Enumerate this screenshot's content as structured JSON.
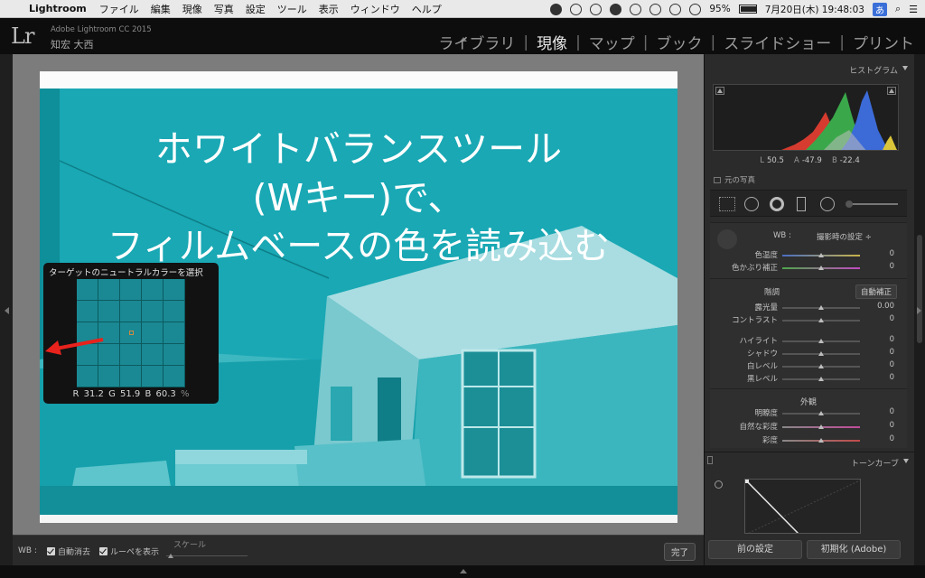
{
  "menubar": {
    "app_name": "Lightroom",
    "menus": [
      "ファイル",
      "編集",
      "現像",
      "写真",
      "設定",
      "ツール",
      "表示",
      "ウィンドウ",
      "ヘルプ"
    ],
    "battery": "95%",
    "datetime": "7月20日(木) 19:48:03",
    "ime": "あ"
  },
  "header": {
    "product": "Adobe Lightroom CC 2015",
    "user": "知宏 大西",
    "modules": [
      "ライブラリ",
      "現像",
      "マップ",
      "ブック",
      "スライドショー",
      "プリント"
    ],
    "active_module": "現像"
  },
  "overlay": {
    "line1": "ホワイトバランスツール",
    "line2": "(Wキー)で、",
    "line3": "フィルムベースの色を読み込む"
  },
  "loupe": {
    "title": "ターゲットのニュートラルカラーを選択",
    "r_label": "R",
    "r_value": "31.2",
    "g_label": "G",
    "g_value": "51.9",
    "b_label": "B",
    "b_value": "60.3",
    "pct": "%"
  },
  "toolbar": {
    "wb_label": "WB :",
    "auto_dismiss": "自動消去",
    "show_loupe": "ルーペを表示",
    "scale": "スケール",
    "done": "完了"
  },
  "histogram": {
    "title": "ヒストグラム",
    "l_label": "L",
    "l_value": "50.5",
    "a_label": "A",
    "a_value": "-47.9",
    "b_label": "B",
    "b_value": "-22.4",
    "original_photo": "元の写真"
  },
  "basic": {
    "wb_label": "WB :",
    "wb_value": "撮影時の設定 ÷",
    "temp_label": "色温度",
    "temp_value": "0",
    "tint_label": "色かぶり補正",
    "tint_value": "0",
    "tone_label": "階調",
    "auto_label": "自動補正",
    "exposure_label": "露光量",
    "exposure_value": "0.00",
    "contrast_label": "コントラスト",
    "contrast_value": "0",
    "highlights_label": "ハイライト",
    "highlights_value": "0",
    "shadows_label": "シャドウ",
    "shadows_value": "0",
    "whites_label": "白レベル",
    "whites_value": "0",
    "blacks_label": "黒レベル",
    "blacks_value": "0",
    "presence_label": "外観",
    "clarity_label": "明瞭度",
    "clarity_value": "0",
    "vibrance_label": "自然な彩度",
    "vibrance_value": "0",
    "saturation_label": "彩度",
    "saturation_value": "0"
  },
  "tone_curve": {
    "title": "トーンカーブ"
  },
  "buttons": {
    "previous": "前の設定",
    "reset": "初期化 (Adobe)"
  },
  "colors": {
    "accent_cyan": "#19a8b4",
    "arrow_red": "#e8221c",
    "panel_bg": "#2b2b2b"
  }
}
